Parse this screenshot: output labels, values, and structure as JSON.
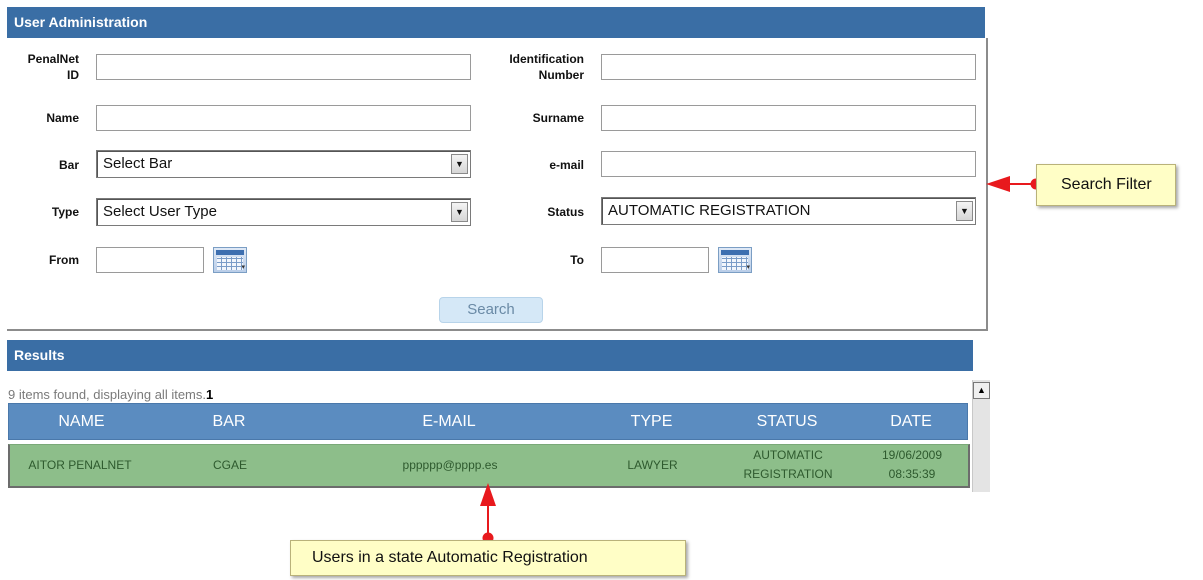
{
  "admin": {
    "title": "User Administration",
    "fields": {
      "penalnet_id": {
        "label_line1": "PenalNet",
        "label_line2": "ID",
        "value": ""
      },
      "identification_number": {
        "label_line1": "Identification",
        "label_line2": "Number",
        "value": ""
      },
      "name": {
        "label": "Name",
        "value": ""
      },
      "surname": {
        "label": "Surname",
        "value": ""
      },
      "bar": {
        "label": "Bar",
        "selected": "Select Bar"
      },
      "email": {
        "label": "e-mail",
        "value": ""
      },
      "type": {
        "label": "Type",
        "selected": "Select User Type"
      },
      "status": {
        "label": "Status",
        "selected": "AUTOMATIC REGISTRATION"
      },
      "from": {
        "label": "From",
        "value": ""
      },
      "to": {
        "label": "To",
        "value": ""
      }
    },
    "search_label": "Search"
  },
  "results": {
    "title": "Results",
    "summary": "9 items found, displaying all items.",
    "page": "1",
    "columns": [
      "NAME",
      "BAR",
      "E-MAIL",
      "TYPE",
      "STATUS",
      "DATE"
    ],
    "rows": [
      {
        "name": "AITOR PENALNET",
        "bar": "CGAE",
        "email": "pppppp@pppp.es",
        "type": "LAWYER",
        "status_line1": "AUTOMATIC",
        "status_line2": "REGISTRATION",
        "date_line1": "19/06/2009",
        "date_line2": "08:35:39"
      }
    ]
  },
  "annotations": {
    "search_filter": "Search Filter",
    "users_state": "Users in a state Automatic Registration"
  },
  "colors": {
    "header_blue": "#3a6ea5",
    "table_header": "#5b8cc0",
    "row_green": "#8dbe8a",
    "callout_yellow": "#fffec6",
    "arrow_red": "#e8191d"
  },
  "icons": {
    "calendar": "calendar-icon",
    "dropdown": "chevron-down-icon",
    "scroll_up": "scroll-up-arrow-icon"
  }
}
